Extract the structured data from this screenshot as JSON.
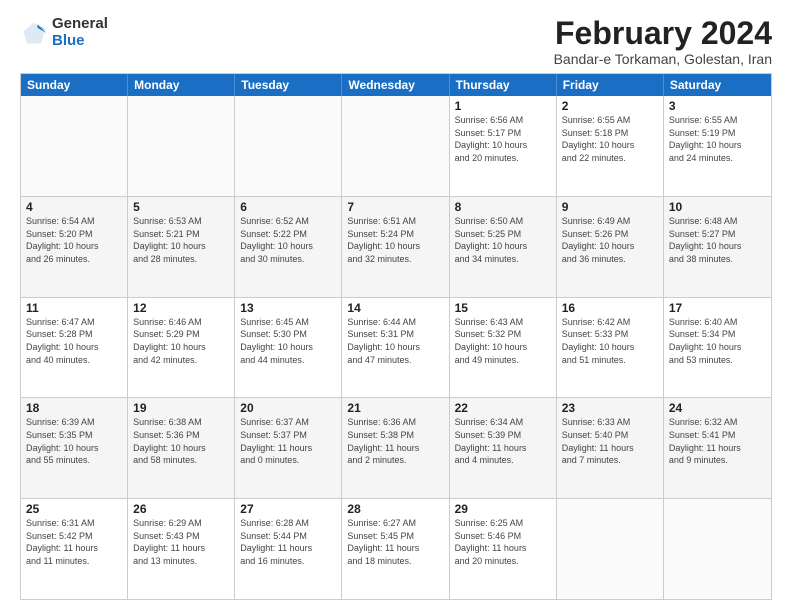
{
  "logo": {
    "general": "General",
    "blue": "Blue"
  },
  "header": {
    "month": "February 2024",
    "location": "Bandar-e Torkaman, Golestan, Iran"
  },
  "weekdays": [
    "Sunday",
    "Monday",
    "Tuesday",
    "Wednesday",
    "Thursday",
    "Friday",
    "Saturday"
  ],
  "rows": [
    [
      {
        "day": "",
        "detail": ""
      },
      {
        "day": "",
        "detail": ""
      },
      {
        "day": "",
        "detail": ""
      },
      {
        "day": "",
        "detail": ""
      },
      {
        "day": "1",
        "detail": "Sunrise: 6:56 AM\nSunset: 5:17 PM\nDaylight: 10 hours\nand 20 minutes."
      },
      {
        "day": "2",
        "detail": "Sunrise: 6:55 AM\nSunset: 5:18 PM\nDaylight: 10 hours\nand 22 minutes."
      },
      {
        "day": "3",
        "detail": "Sunrise: 6:55 AM\nSunset: 5:19 PM\nDaylight: 10 hours\nand 24 minutes."
      }
    ],
    [
      {
        "day": "4",
        "detail": "Sunrise: 6:54 AM\nSunset: 5:20 PM\nDaylight: 10 hours\nand 26 minutes."
      },
      {
        "day": "5",
        "detail": "Sunrise: 6:53 AM\nSunset: 5:21 PM\nDaylight: 10 hours\nand 28 minutes."
      },
      {
        "day": "6",
        "detail": "Sunrise: 6:52 AM\nSunset: 5:22 PM\nDaylight: 10 hours\nand 30 minutes."
      },
      {
        "day": "7",
        "detail": "Sunrise: 6:51 AM\nSunset: 5:24 PM\nDaylight: 10 hours\nand 32 minutes."
      },
      {
        "day": "8",
        "detail": "Sunrise: 6:50 AM\nSunset: 5:25 PM\nDaylight: 10 hours\nand 34 minutes."
      },
      {
        "day": "9",
        "detail": "Sunrise: 6:49 AM\nSunset: 5:26 PM\nDaylight: 10 hours\nand 36 minutes."
      },
      {
        "day": "10",
        "detail": "Sunrise: 6:48 AM\nSunset: 5:27 PM\nDaylight: 10 hours\nand 38 minutes."
      }
    ],
    [
      {
        "day": "11",
        "detail": "Sunrise: 6:47 AM\nSunset: 5:28 PM\nDaylight: 10 hours\nand 40 minutes."
      },
      {
        "day": "12",
        "detail": "Sunrise: 6:46 AM\nSunset: 5:29 PM\nDaylight: 10 hours\nand 42 minutes."
      },
      {
        "day": "13",
        "detail": "Sunrise: 6:45 AM\nSunset: 5:30 PM\nDaylight: 10 hours\nand 44 minutes."
      },
      {
        "day": "14",
        "detail": "Sunrise: 6:44 AM\nSunset: 5:31 PM\nDaylight: 10 hours\nand 47 minutes."
      },
      {
        "day": "15",
        "detail": "Sunrise: 6:43 AM\nSunset: 5:32 PM\nDaylight: 10 hours\nand 49 minutes."
      },
      {
        "day": "16",
        "detail": "Sunrise: 6:42 AM\nSunset: 5:33 PM\nDaylight: 10 hours\nand 51 minutes."
      },
      {
        "day": "17",
        "detail": "Sunrise: 6:40 AM\nSunset: 5:34 PM\nDaylight: 10 hours\nand 53 minutes."
      }
    ],
    [
      {
        "day": "18",
        "detail": "Sunrise: 6:39 AM\nSunset: 5:35 PM\nDaylight: 10 hours\nand 55 minutes."
      },
      {
        "day": "19",
        "detail": "Sunrise: 6:38 AM\nSunset: 5:36 PM\nDaylight: 10 hours\nand 58 minutes."
      },
      {
        "day": "20",
        "detail": "Sunrise: 6:37 AM\nSunset: 5:37 PM\nDaylight: 11 hours\nand 0 minutes."
      },
      {
        "day": "21",
        "detail": "Sunrise: 6:36 AM\nSunset: 5:38 PM\nDaylight: 11 hours\nand 2 minutes."
      },
      {
        "day": "22",
        "detail": "Sunrise: 6:34 AM\nSunset: 5:39 PM\nDaylight: 11 hours\nand 4 minutes."
      },
      {
        "day": "23",
        "detail": "Sunrise: 6:33 AM\nSunset: 5:40 PM\nDaylight: 11 hours\nand 7 minutes."
      },
      {
        "day": "24",
        "detail": "Sunrise: 6:32 AM\nSunset: 5:41 PM\nDaylight: 11 hours\nand 9 minutes."
      }
    ],
    [
      {
        "day": "25",
        "detail": "Sunrise: 6:31 AM\nSunset: 5:42 PM\nDaylight: 11 hours\nand 11 minutes."
      },
      {
        "day": "26",
        "detail": "Sunrise: 6:29 AM\nSunset: 5:43 PM\nDaylight: 11 hours\nand 13 minutes."
      },
      {
        "day": "27",
        "detail": "Sunrise: 6:28 AM\nSunset: 5:44 PM\nDaylight: 11 hours\nand 16 minutes."
      },
      {
        "day": "28",
        "detail": "Sunrise: 6:27 AM\nSunset: 5:45 PM\nDaylight: 11 hours\nand 18 minutes."
      },
      {
        "day": "29",
        "detail": "Sunrise: 6:25 AM\nSunset: 5:46 PM\nDaylight: 11 hours\nand 20 minutes."
      },
      {
        "day": "",
        "detail": ""
      },
      {
        "day": "",
        "detail": ""
      }
    ]
  ]
}
